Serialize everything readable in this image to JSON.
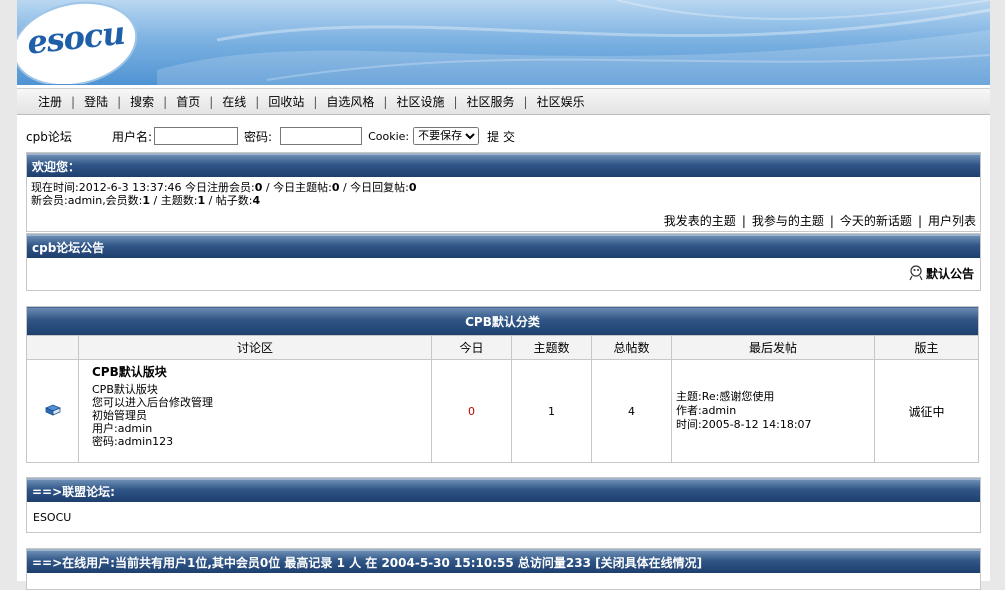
{
  "brand": {
    "logo_text": "esocu"
  },
  "nav": [
    "注册",
    "登陆",
    "搜索",
    "首页",
    "在线",
    "回收站",
    "自选风格",
    "社区设施",
    "社区服务",
    "社区娱乐"
  ],
  "login": {
    "forum_name": "cpb论坛",
    "username_label": "用户名:",
    "password_label": "密码:",
    "cookie_label": "Cookie:",
    "cookie_selected": "不要保存",
    "submit_label": "提 交"
  },
  "welcome": {
    "header": "欢迎您：",
    "line1": {
      "time_label": "现在时间:",
      "time": "2012-6-3 13:37:46",
      "reg_label": " 今日注册会员:",
      "reg": "0",
      "topics_label": " / 今日主题帖:",
      "topics": "0",
      "replies_label": " / 今日回复帖:",
      "replies": "0"
    },
    "line2": {
      "new_member_label": "新会员:",
      "new_member": "admin",
      "members_label": ",会员数:",
      "members": "1",
      "threads_label": " / 主题数:",
      "threads": "1",
      "posts_label": " / 帖子数:",
      "posts": "4"
    },
    "links": [
      "我发表的主题",
      "我参与的主题",
      "今天的新话题",
      "用户列表"
    ]
  },
  "announcement": {
    "header": "cpb论坛公告",
    "link": "默认公告"
  },
  "category": {
    "title": "CPB默认分类",
    "columns": [
      "讨论区",
      "今日",
      "主题数",
      "总帖数",
      "最后发帖",
      "版主"
    ],
    "board": {
      "name": "CPB默认版块",
      "desc1": "CPB默认版块",
      "desc2": "您可以进入后台修改管理",
      "desc3": "初始管理员",
      "desc4": "用户:admin",
      "desc5": "密码:admin123",
      "today": "0",
      "topics": "1",
      "posts": "4",
      "last_subject": "主题:Re:感谢您使用",
      "last_author": "作者:admin",
      "last_time": "时间:2005-8-12 14:18:07",
      "moderator": "诚征中"
    }
  },
  "union": {
    "header": "==>联盟论坛:",
    "item": "ESOCU"
  },
  "online": {
    "header": "==>在线用户:当前共有用户1位,其中会员0位  最高记录  1 人  在  2004-5-30 15:10:55 总访问量233 [关闭具体在线情况]"
  },
  "colors": {
    "header_dark": "#1d3f6e",
    "header_light": "#6c8db3",
    "accent_red": "#c00000"
  }
}
